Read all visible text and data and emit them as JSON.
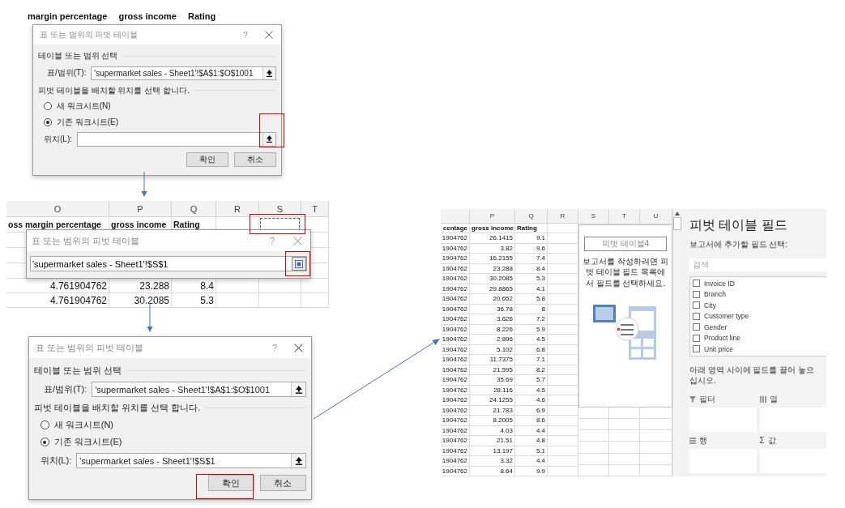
{
  "sheet_scrap": [
    "margin percentage",
    "gross income",
    "Rating"
  ],
  "dialog_1": {
    "title": "표 또는 범위의 피벗 테이블",
    "help": "?",
    "section_label": "테이블 또는 범위 선택",
    "range_label": "표/범위(T):",
    "range_value": "'supermarket sales - Sheet1'!$A$1:$O$1001",
    "placement_label": "피벗 테이블을 배치할 위치를 선택 합니다.",
    "options": [
      {
        "label": "새 워크시트(N)",
        "selected": false
      },
      {
        "label": "기존 워크시트(E)",
        "selected": true
      }
    ],
    "location_label": "위치(L):",
    "buttons": [
      "확인",
      "취소"
    ]
  },
  "sheet_snippet": {
    "columns": [
      "O",
      "P",
      "Q",
      "R",
      "S",
      "T"
    ],
    "header_row": [
      "oss margin percentage",
      "gross income",
      "Rating"
    ],
    "rows": [
      [
        "4.761904762",
        "23.288",
        "8.4"
      ],
      [
        "4.761904762",
        "30.2085",
        "5.3"
      ]
    ],
    "collapsed_dialog": {
      "title": "표 또는 범위의 피벗 테이블",
      "help": "?",
      "value": "'supermarket sales - Sheet1'!$S$1"
    }
  },
  "dialog_2": {
    "title": "표 또는 범위의 피벗 테이블",
    "help": "?",
    "section_label": "테이블 또는 범위 선택",
    "range_label": "표/범위(T):",
    "range_value": "'supermarket sales - Sheet1'!$A$1:$O$1001",
    "placement_label": "피벗 테이블을 배치할 위치를 선택 합니다.",
    "options": [
      {
        "label": "새 워크시트(N)",
        "selected": false
      },
      {
        "label": "기존 워크시트(E)",
        "selected": true
      }
    ],
    "location_label": "위치(L):",
    "location_value": "'supermarket sales - Sheet1'!$S$1",
    "buttons": [
      "확인",
      "취소"
    ]
  },
  "excel_view": {
    "columns": [
      "P",
      "Q",
      "R"
    ],
    "pivot_columns": [
      "S",
      "T",
      "U"
    ],
    "header_row": [
      "centage",
      "gross income",
      "Rating"
    ],
    "rows": [
      [
        "1904762",
        "26.1415",
        "9.1"
      ],
      [
        "1904762",
        "3.82",
        "9.6"
      ],
      [
        "1904762",
        "16.2155",
        "7.4"
      ],
      [
        "1904762",
        "23.288",
        "8.4"
      ],
      [
        "1904762",
        "30.2085",
        "5.3"
      ],
      [
        "1904762",
        "29.8865",
        "4.1"
      ],
      [
        "1904762",
        "20.652",
        "5.8"
      ],
      [
        "1904762",
        "36.78",
        "8"
      ],
      [
        "1904762",
        "3.626",
        "7.2"
      ],
      [
        "1904762",
        "8.226",
        "5.9"
      ],
      [
        "1904762",
        "2.896",
        "4.5"
      ],
      [
        "1904762",
        "5.102",
        "6.8"
      ],
      [
        "1904762",
        "11.7375",
        "7.1"
      ],
      [
        "1904762",
        "21.595",
        "8.2"
      ],
      [
        "1904762",
        "35.69",
        "5.7"
      ],
      [
        "1904762",
        "28.116",
        "4.5"
      ],
      [
        "1904762",
        "24.1255",
        "4.6"
      ],
      [
        "1904762",
        "21.783",
        "6.9"
      ],
      [
        "1904762",
        "8.2005",
        "8.6"
      ],
      [
        "1904762",
        "4.03",
        "4.4"
      ],
      [
        "1904762",
        "21.51",
        "4.8"
      ],
      [
        "1904762",
        "13.197",
        "5.1"
      ],
      [
        "1904762",
        "3.32",
        "4.4"
      ],
      [
        "1904762",
        "8.64",
        "9.9"
      ]
    ],
    "pivot_placeholder": {
      "name": "피벗 테이블4",
      "instructions": "보고서를 작성하려면 피벗 테이블 필드 목록에서 필드를 선택하세요."
    },
    "field_pane": {
      "title": "피벗 테이블 필드",
      "subtitle": "보고서에 추가할 필드 선택:",
      "search_placeholder": "검색",
      "fields": [
        {
          "label": "Invoice ID",
          "checked": false
        },
        {
          "label": "Branch",
          "checked": false
        },
        {
          "label": "City",
          "checked": false
        },
        {
          "label": "Customer type",
          "checked": false
        },
        {
          "label": "Gender",
          "checked": false
        },
        {
          "label": "Product line",
          "checked": false
        },
        {
          "label": "Unit price",
          "checked": false
        }
      ],
      "drag_hint": "아래 영역 사이에 필드를 끌어 놓으십시오.",
      "areas": [
        {
          "kind": "filter",
          "label": "필터"
        },
        {
          "kind": "columns",
          "label": "열"
        },
        {
          "kind": "rows",
          "label": "행"
        },
        {
          "kind": "values",
          "icon": "Σ",
          "label": "값"
        }
      ]
    }
  }
}
